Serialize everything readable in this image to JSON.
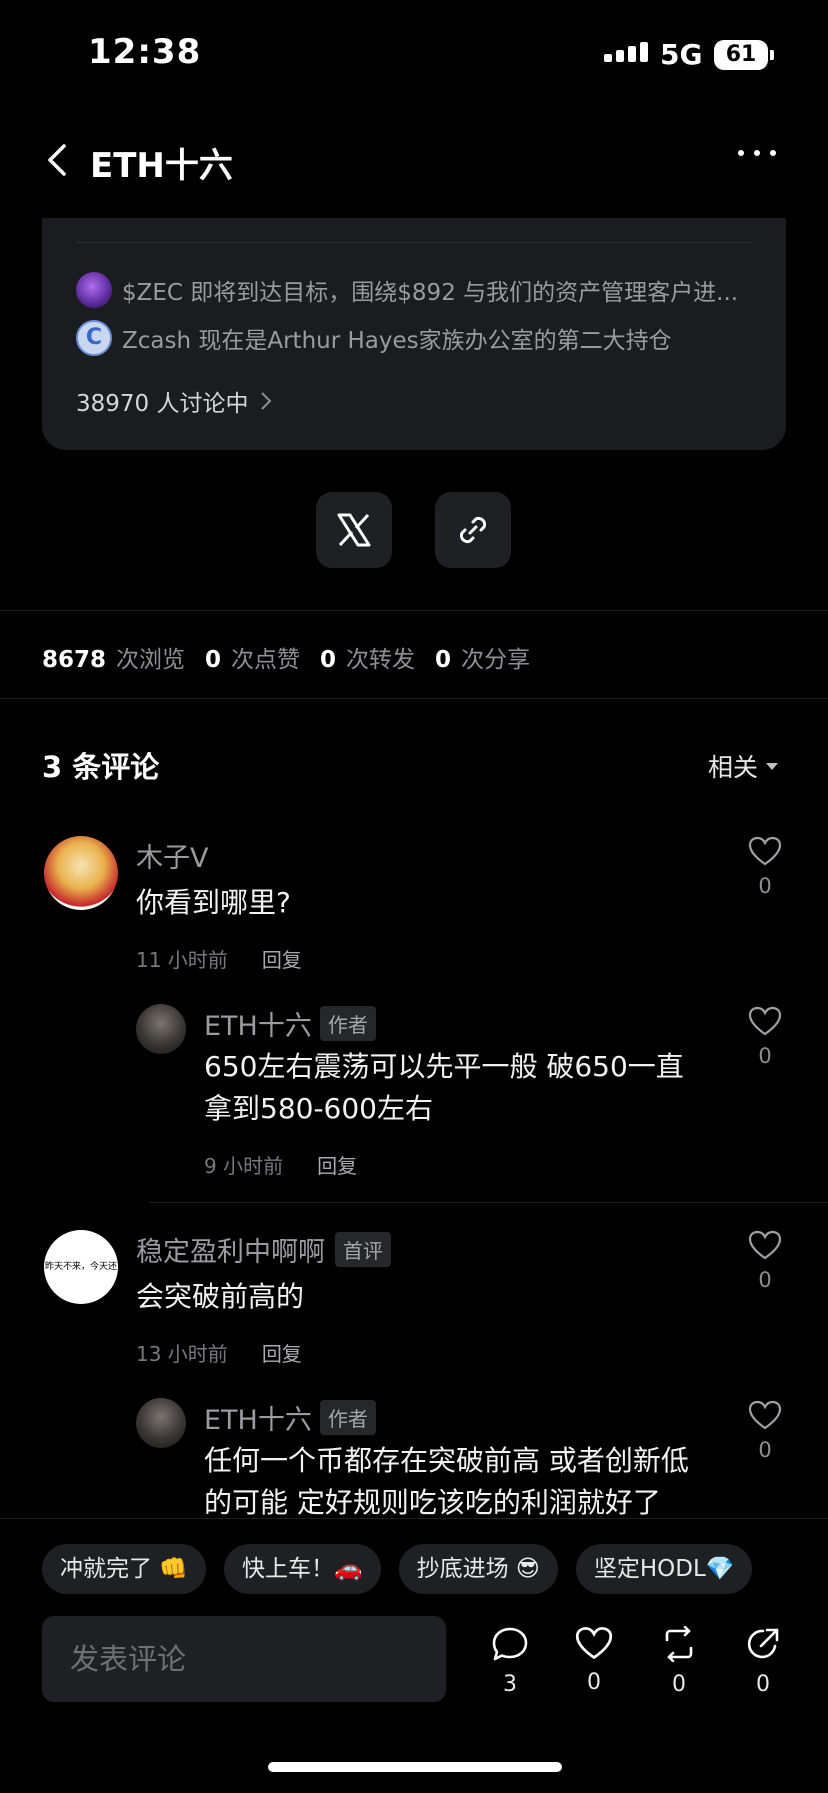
{
  "status_bar": {
    "time": "12:38",
    "network": "5G",
    "battery": "61"
  },
  "header": {
    "title": "ETH十六"
  },
  "topic_card": {
    "items": [
      {
        "icon": "purple-avatar-icon",
        "text": "$ZEC 即将到达目标，围绕$892 与我们的资产管理客户进..."
      },
      {
        "icon": "zcash-icon",
        "text": "Zcash 现在是Arthur Hayes家族办公室的第二大持仓"
      }
    ],
    "discussion": "38970 人讨论中"
  },
  "share": {
    "x_icon": "x-logo-icon",
    "link_icon": "link-icon"
  },
  "stats": [
    {
      "num": "8678",
      "label": "次浏览"
    },
    {
      "num": "0",
      "label": "次点赞"
    },
    {
      "num": "0",
      "label": "次转发"
    },
    {
      "num": "0",
      "label": "次分享"
    }
  ],
  "comments_header": {
    "title": "3 条评论",
    "sort": "相关"
  },
  "comments": [
    {
      "user": "木子V",
      "text": "你看到哪里?",
      "time": "11 小时前",
      "reply": "回复",
      "likes": "0",
      "replies": [
        {
          "user": "ETH十六",
          "badge": "作者",
          "text1": "650左右震荡可以先平一般  破650一直",
          "text2": "拿到580-600左右",
          "time": "9 小时前",
          "reply": "回复",
          "likes": "0"
        }
      ]
    },
    {
      "user": "稳定盈利中啊啊",
      "badge": "首评",
      "avatar_text": "昨天不来，今天还不来吗?",
      "text": "会突破前高的",
      "time": "13 小时前",
      "reply": "回复",
      "likes": "0",
      "replies": [
        {
          "user": "ETH十六",
          "badge": "作者",
          "text1": "任何一个币都存在突破前高 或者创新低",
          "text2": "的可能  定好规则吃该吃的利润就好了",
          "likes": "0"
        }
      ]
    }
  ],
  "quick_replies": [
    "冲就完了 👊",
    "快上车！🚗",
    "抄底进场 😎",
    "坚定HODL💎"
  ],
  "composer": {
    "placeholder": "发表评论"
  },
  "actions": [
    {
      "icon": "comment-icon",
      "count": "3"
    },
    {
      "icon": "heart-icon",
      "count": "0"
    },
    {
      "icon": "repost-icon",
      "count": "0"
    },
    {
      "icon": "share-icon",
      "count": "0"
    }
  ]
}
